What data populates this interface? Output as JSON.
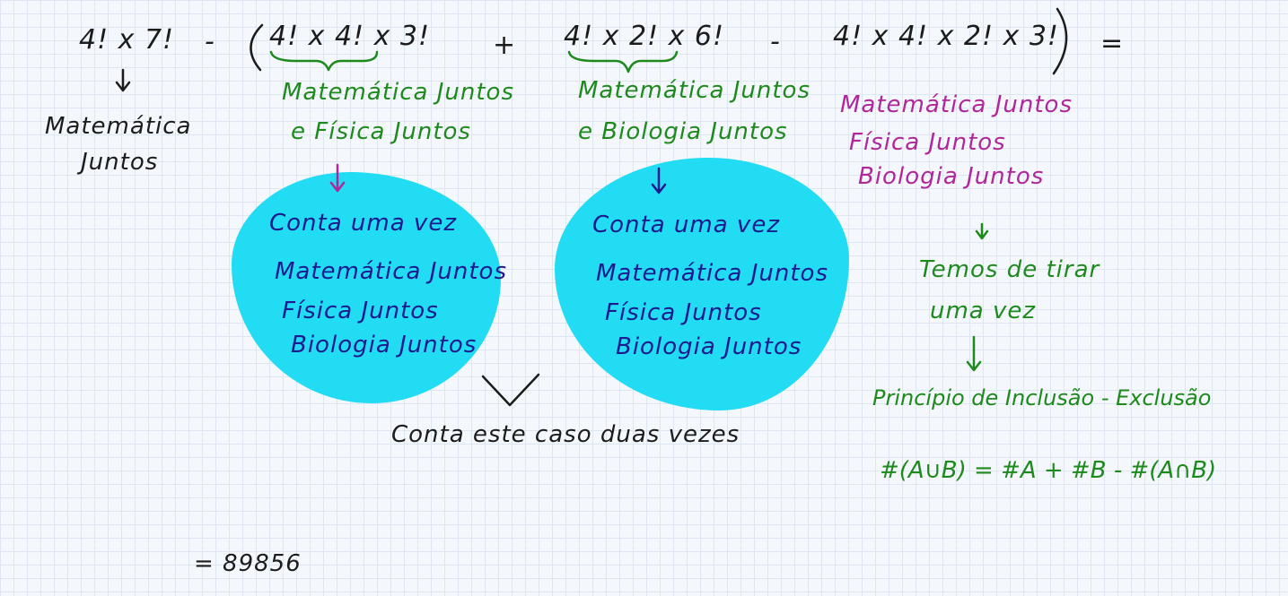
{
  "board": {
    "colors": {
      "background": "#f4f7fb",
      "grid": "#dde6f1",
      "black_ink": "#1c1c1c",
      "green_ink": "#1e8a1e",
      "magenta_ink": "#b0269b",
      "navy_ink": "#1c1a8e",
      "highlight": "#21dcf2"
    },
    "equation": {
      "t1": "4! x 7!",
      "minus1": "-",
      "t2": "4! x 4! x 3!",
      "plus": "+",
      "t3": "4! x 2! x 6!",
      "minus2": "-",
      "t4": "4! x 4! x 2! x 3!",
      "equals": "="
    },
    "note_left": {
      "line1": "Matemática",
      "line2": "Juntos"
    },
    "note_green1": {
      "line1": "Matemática Juntos",
      "line2": "e Física Juntos"
    },
    "note_green2": {
      "line1": "Matemática Juntos",
      "line2": "e Biologia Juntos"
    },
    "note_magenta": {
      "line1": "Matemática Juntos",
      "line2": "Física Juntos",
      "line3": "Biologia Juntos"
    },
    "box1": {
      "line1": "Conta uma vez",
      "line2": "Matemática Juntos",
      "line3": "Física Juntos",
      "line4": "Biologia Juntos"
    },
    "box2": {
      "line1": "Conta uma vez",
      "line2": "Matemática Juntos",
      "line3": "Física Juntos",
      "line4": "Biologia Juntos"
    },
    "note_bottom": "Conta este caso duas vezes",
    "note_right": {
      "line1": "Temos de tirar",
      "line2": "uma vez",
      "line3": "Princípio de Inclusão - Exclusão",
      "formula": "#(A∪B) = #A + #B - #(A∩B)"
    },
    "result": "= 89856"
  }
}
